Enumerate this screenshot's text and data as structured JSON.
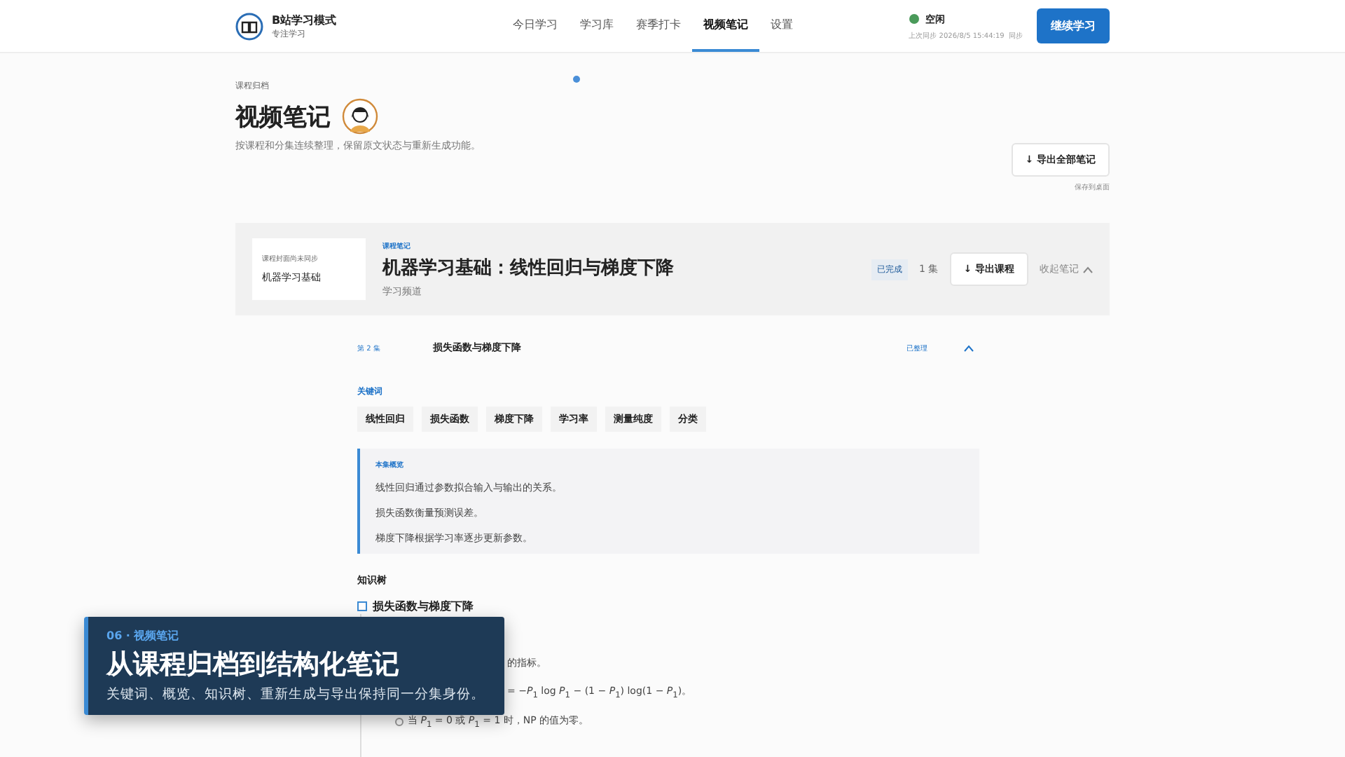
{
  "header": {
    "app_name": "B站学习模式",
    "app_subtitle": "专注学习",
    "nav": [
      {
        "label": "今日学习",
        "selected": false
      },
      {
        "label": "学习库",
        "selected": false
      },
      {
        "label": "赛季打卡",
        "selected": false
      },
      {
        "label": "视频笔记",
        "selected": true
      },
      {
        "label": "设置",
        "selected": false
      }
    ],
    "status": {
      "label": "空闲",
      "color": "#4a9a5a"
    },
    "sync_text": "上次同步 2026/8/5 15:44:19  同步",
    "primary_button": "继续学习"
  },
  "page": {
    "breadcrumb": "课程归档",
    "title": "视频笔记",
    "subtitle": "按课程和分集连续整理，保留原文状态与重新生成功能。",
    "export_all_button": "↓ 导出全部笔记",
    "export_hint": "保存到桌面"
  },
  "course": {
    "cover_status": "课程封面尚未同步",
    "cover_title": "机器学习基础",
    "tag": "课程笔记",
    "title": "机器学习基础：线性回归与梯度下降",
    "channel": "学习频道",
    "status_badge": "已完成",
    "episode_count": "1 集",
    "export_button": "↓ 导出课程",
    "collapse_button": "收起笔记",
    "expanded": true
  },
  "episode": {
    "number": "第 2 集",
    "title": "损失函数与梯度下降",
    "status": "已整理",
    "expanded": true,
    "keywords_label": "关键词",
    "keywords": [
      "线性回归",
      "损失函数",
      "梯度下降",
      "学习率",
      "测量纯度",
      "分类"
    ],
    "summary_label": "本集概览",
    "summary": [
      "线性回归通过参数拟合输入与输出的关系。",
      "损失函数衡量预测误差。",
      "梯度下降根据学习率逐步更新参数。"
    ],
    "tree_label": "知识树",
    "tree": [
      {
        "label": "损失函数与梯度下降",
        "checked": false,
        "children": [
          {
            "kind": "partial",
            "text": "的指标。"
          },
          {
            "kind": "partial",
            "text": "= −*P*$_{1}$ log *P*$_{1}$ − (1 − *P*$_{1}$) log(1 − *P*$_{1}$)。"
          },
          {
            "kind": "bullet",
            "text": "当 *P*$_{1}$ = 0 或 *P*$_{1}$ = 1 时，NP 的值为零。"
          }
        ]
      }
    ]
  },
  "overlay": {
    "eyebrow": "06 · 视频笔记",
    "title": "从课程归档到结构化笔记",
    "text": "关键词、概览、知识树、重新生成与导出保持同一分集身份。"
  }
}
